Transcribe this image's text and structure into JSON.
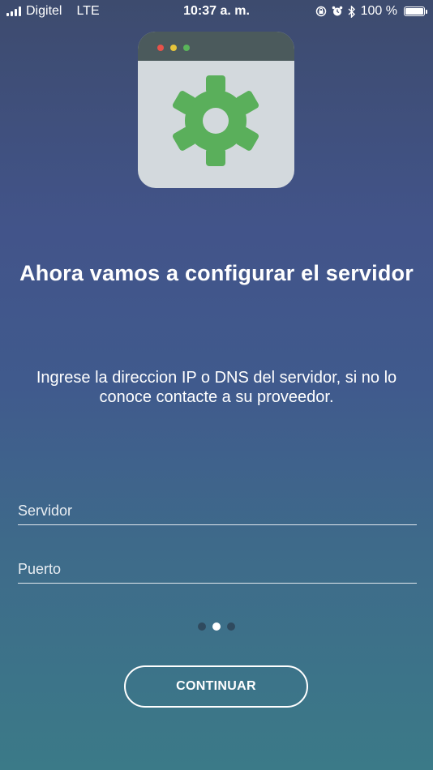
{
  "status_bar": {
    "carrier": "Digitel",
    "network": "LTE",
    "time": "10:37 a. m.",
    "battery": "100 %",
    "battery_level": 1.0,
    "icons": [
      "signal-icon",
      "rotation-lock-icon",
      "alarm-icon",
      "bluetooth-icon",
      "battery-icon"
    ]
  },
  "illustration": {
    "icon": "gear-icon",
    "window_dots": [
      "#e8524a",
      "#e6c53b",
      "#5ab55a"
    ],
    "gear_color": "#5aaf5b",
    "window_bg": "#d3d9dd",
    "bar_bg": "#4b5a5c"
  },
  "main": {
    "title": "Ahora vamos a configurar el servidor",
    "subtitle": "Ingrese la direccion IP o DNS del servidor, si no lo conoce contacte a su proveedor."
  },
  "form": {
    "server_placeholder": "Servidor",
    "server_value": "",
    "port_placeholder": "Puerto",
    "port_value": ""
  },
  "pager": {
    "total": 3,
    "active_index": 1
  },
  "actions": {
    "continue_label": "CONTINUAR"
  }
}
